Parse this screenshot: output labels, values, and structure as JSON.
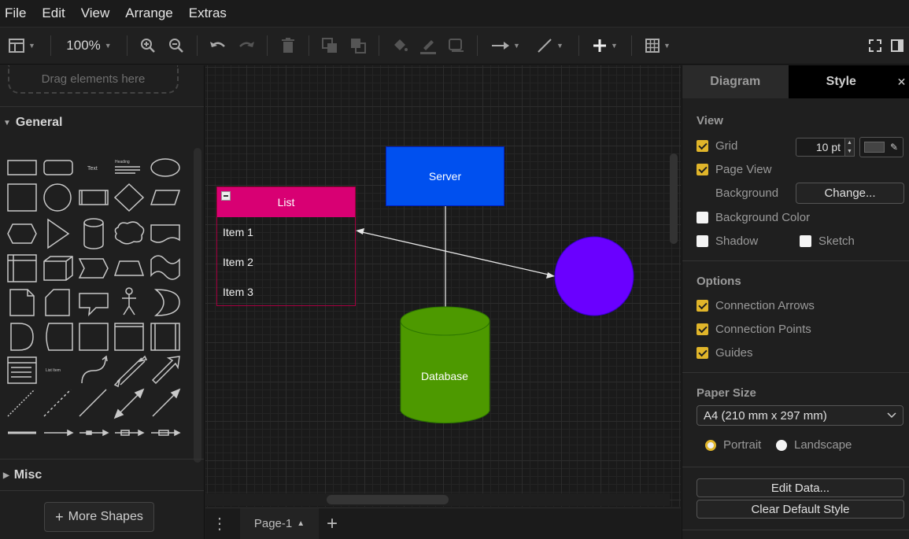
{
  "menu": [
    "File",
    "Edit",
    "View",
    "Arrange",
    "Extras"
  ],
  "toolbar": {
    "zoom": "100%"
  },
  "left_panel": {
    "drop_hint": "Drag elements here",
    "general_label": "General",
    "misc_label": "Misc",
    "more_shapes_label": "More Shapes"
  },
  "diagram": {
    "server_label": "Server",
    "list_title": "List",
    "list_items": [
      "Item 1",
      "Item 2",
      "Item 3"
    ],
    "database_label": "Database",
    "colors": {
      "server": "#0050ef",
      "list": "#d80073",
      "database": "#4d9900",
      "circle": "#6a00ff"
    }
  },
  "page_tabs": {
    "current": "Page-1"
  },
  "right_panel": {
    "tabs": [
      "Diagram",
      "Style"
    ],
    "view": {
      "title": "View",
      "grid": "Grid",
      "grid_size": "10 pt",
      "page_view": "Page View",
      "background": "Background",
      "change_button": "Change...",
      "background_color": "Background Color",
      "shadow": "Shadow",
      "sketch": "Sketch"
    },
    "options": {
      "title": "Options",
      "connection_arrows": "Connection Arrows",
      "connection_points": "Connection Points",
      "guides": "Guides"
    },
    "paper": {
      "title": "Paper Size",
      "size": "A4 (210 mm x 297 mm)",
      "portrait": "Portrait",
      "landscape": "Landscape"
    },
    "buttons": {
      "edit_data": "Edit Data...",
      "clear_style": "Clear Default Style"
    }
  }
}
